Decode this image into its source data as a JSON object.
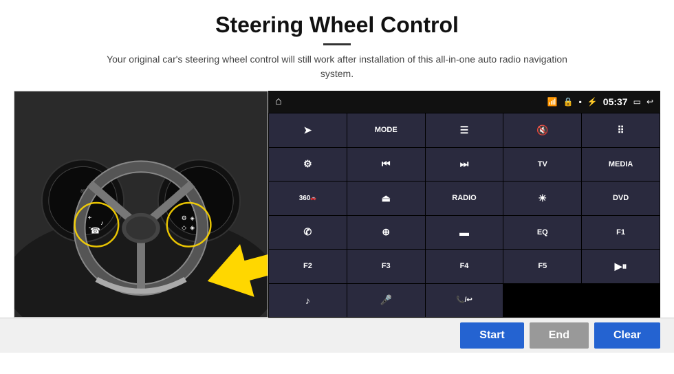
{
  "header": {
    "title": "Steering Wheel Control",
    "subtitle": "Your original car's steering wheel control will still work after installation of this all-in-one auto radio navigation system."
  },
  "topbar": {
    "home_icon": "⌂",
    "wifi_icon": "wifi",
    "lock_icon": "🔒",
    "sd_icon": "📁",
    "bt_icon": "bluetooth",
    "time": "05:37",
    "screen_icon": "screen",
    "back_icon": "back"
  },
  "buttons": [
    {
      "id": "row1c1",
      "label": "",
      "icon": "send",
      "col": 1,
      "row": 1
    },
    {
      "id": "row1c2",
      "label": "MODE",
      "col": 2,
      "row": 1
    },
    {
      "id": "row1c3",
      "label": "",
      "icon": "list",
      "col": 3,
      "row": 1
    },
    {
      "id": "row1c4",
      "label": "",
      "icon": "mute",
      "col": 4,
      "row": 1
    },
    {
      "id": "row1c5",
      "label": "",
      "icon": "apps",
      "col": 5,
      "row": 1
    },
    {
      "id": "row2c1",
      "label": "",
      "icon": "settings",
      "col": 1,
      "row": 2
    },
    {
      "id": "row2c2",
      "label": "",
      "icon": "prev",
      "col": 2,
      "row": 2
    },
    {
      "id": "row2c3",
      "label": "",
      "icon": "next",
      "col": 3,
      "row": 2
    },
    {
      "id": "row2c4",
      "label": "TV",
      "col": 4,
      "row": 2
    },
    {
      "id": "row2c5",
      "label": "MEDIA",
      "col": 5,
      "row": 2
    },
    {
      "id": "row3c1",
      "label": "360",
      "icon": "360",
      "col": 1,
      "row": 3
    },
    {
      "id": "row3c2",
      "label": "",
      "icon": "eject",
      "col": 2,
      "row": 3
    },
    {
      "id": "row3c3",
      "label": "RADIO",
      "col": 3,
      "row": 3
    },
    {
      "id": "row3c4",
      "label": "",
      "icon": "sun",
      "col": 4,
      "row": 3
    },
    {
      "id": "row3c5",
      "label": "DVD",
      "col": 5,
      "row": 3
    },
    {
      "id": "row4c1",
      "label": "",
      "icon": "phone",
      "col": 1,
      "row": 4
    },
    {
      "id": "row4c2",
      "label": "",
      "icon": "nav",
      "col": 2,
      "row": 4
    },
    {
      "id": "row4c3",
      "label": "",
      "icon": "screen",
      "col": 3,
      "row": 4
    },
    {
      "id": "row4c4",
      "label": "EQ",
      "col": 4,
      "row": 4
    },
    {
      "id": "row4c5",
      "label": "F1",
      "col": 5,
      "row": 4
    },
    {
      "id": "row5c1",
      "label": "F2",
      "col": 1,
      "row": 5
    },
    {
      "id": "row5c2",
      "label": "F3",
      "col": 2,
      "row": 5
    },
    {
      "id": "row5c3",
      "label": "F4",
      "col": 3,
      "row": 5
    },
    {
      "id": "row5c4",
      "label": "F5",
      "col": 4,
      "row": 5
    },
    {
      "id": "row5c5",
      "label": "",
      "icon": "playpause",
      "col": 5,
      "row": 5
    },
    {
      "id": "row6c1",
      "label": "",
      "icon": "music",
      "col": 1,
      "row": 6
    },
    {
      "id": "row6c2",
      "label": "",
      "icon": "mic",
      "col": 2,
      "row": 6
    },
    {
      "id": "row6c3",
      "label": "",
      "icon": "call",
      "col": 3,
      "row": 6
    }
  ],
  "bottom_buttons": {
    "start": "Start",
    "end": "End",
    "clear": "Clear"
  }
}
